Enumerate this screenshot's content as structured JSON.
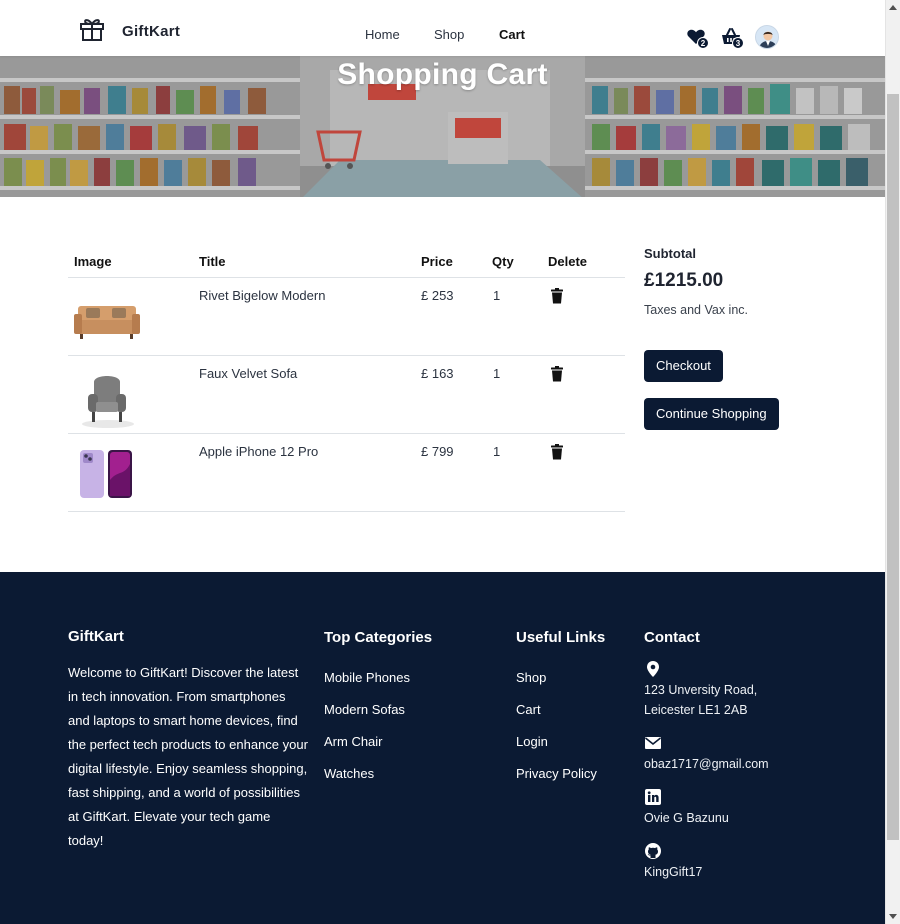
{
  "brand": {
    "name": "GiftKart",
    "logo_icon": "gift-icon"
  },
  "nav": {
    "home": "Home",
    "shop": "Shop",
    "cart": "Cart"
  },
  "header_icons": {
    "wishlist": {
      "icon": "heart-icon",
      "count": "2"
    },
    "basket": {
      "icon": "basket-icon",
      "count": "3"
    },
    "profile": {
      "icon": "user-avatar"
    }
  },
  "hero": {
    "title": "Shopping Cart"
  },
  "cart": {
    "columns": {
      "image": "Image",
      "title": "Title",
      "price": "Price",
      "qty": "Qty",
      "delete": "Delete"
    },
    "items": [
      {
        "title": "Rivet Bigelow Modern",
        "price": "£ 253",
        "qty": "1",
        "image": "sofa-image"
      },
      {
        "title": "Faux Velvet Sofa",
        "price": "£ 163",
        "qty": "1",
        "image": "armchair-image"
      },
      {
        "title": "Apple iPhone 12 Pro",
        "price": "£ 799",
        "qty": "1",
        "image": "phone-image"
      }
    ]
  },
  "summary": {
    "label": "Subtotal",
    "total": "£1215.00",
    "note": "Taxes and Vax inc.",
    "checkout": "Checkout",
    "continue": "Continue Shopping"
  },
  "footer": {
    "about": {
      "title": "GiftKart",
      "text": "Welcome to GiftKart! Discover the latest in tech innovation. From smartphones and laptops to smart home devices, find the perfect tech products to enhance your digital lifestyle. Enjoy seamless shopping, fast shipping, and a world of possibilities at GiftKart. Elevate your tech game today!"
    },
    "categories": {
      "title": "Top Categories",
      "items": [
        "Mobile Phones",
        "Modern Sofas",
        "Arm Chair",
        "Watches"
      ]
    },
    "links": {
      "title": "Useful Links",
      "items": [
        "Shop",
        "Cart",
        "Login",
        "Privacy Policy"
      ]
    },
    "contact": {
      "title": "Contact",
      "address_line1": "123 Unversity Road,",
      "address_line2": "Leicester LE1 2AB",
      "email": "obaz1717@gmail.com",
      "linkedin": "Ovie G Bazunu",
      "github": "KingGift17"
    }
  },
  "colors": {
    "navy": "#0b1a33",
    "text": "#1f2430",
    "divider": "#dee2e6"
  }
}
